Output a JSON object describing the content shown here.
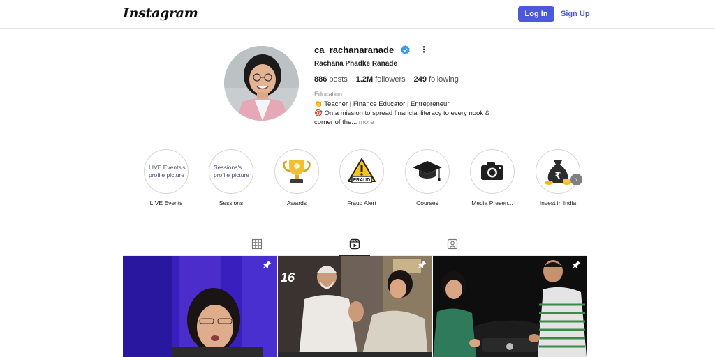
{
  "nav": {
    "logo": "Instagram",
    "login_label": "Log In",
    "signup_label": "Sign Up"
  },
  "profile": {
    "username": "ca_rachanaranade",
    "full_name": "Rachana Phadke Ranade",
    "stats": {
      "posts_value": "886",
      "posts_label": "posts",
      "followers_value": "1.2M",
      "followers_label": "followers",
      "following_value": "249",
      "following_label": "following"
    },
    "category": "Education",
    "bio_line1": "👏 Teacher | Finance Educator | Entrepreneur",
    "bio_line2": "🎯 On a mission to spread financial literacy to every nook & corner of the...",
    "bio_more": "more"
  },
  "highlights": [
    {
      "label": "LIVE Events",
      "alt_text": "LIVE Events's profile picture"
    },
    {
      "label": "Sessions",
      "alt_text": "Sessions's profile picture"
    },
    {
      "label": "Awards",
      "icon": "trophy-icon"
    },
    {
      "label": "Fraud Alert",
      "icon": "fraud-warning-icon",
      "badge_text": "FRAUD"
    },
    {
      "label": "Courses",
      "icon": "graduation-cap-icon"
    },
    {
      "label": "Media Presen...",
      "icon": "camera-icon"
    },
    {
      "label": "Invest in India",
      "icon": "rupee-money-bag-icon"
    }
  ],
  "tabs": [
    {
      "name": "posts",
      "icon": "grid-icon",
      "active": false
    },
    {
      "name": "reels",
      "icon": "reels-icon",
      "active": true
    },
    {
      "name": "tagged",
      "icon": "tagged-icon",
      "active": false
    }
  ],
  "posts": [
    {
      "pinned": true,
      "overlay_text": ""
    },
    {
      "pinned": true,
      "overlay_text": "16"
    },
    {
      "pinned": true,
      "overlay_text": ""
    }
  ],
  "colors": {
    "primary_button": "#4c5ad8",
    "verified_badge": "#3b9af0"
  }
}
